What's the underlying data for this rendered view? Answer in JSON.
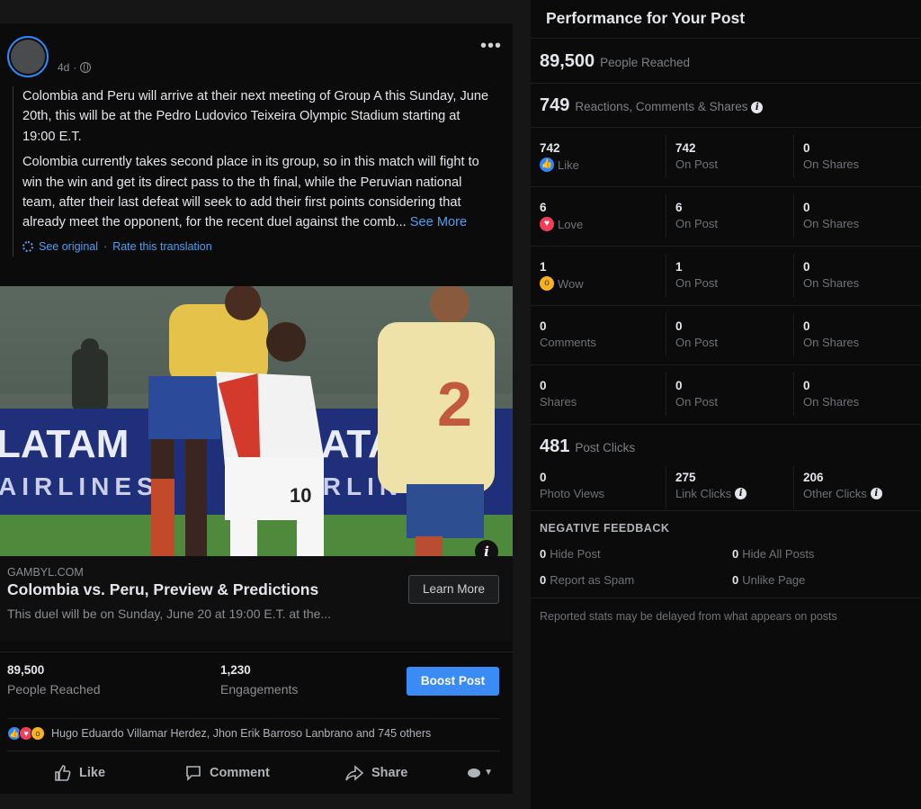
{
  "post": {
    "time": "4d",
    "more_label": "•••",
    "paragraph1": "Colombia and Peru will arrive at their next meeting of Group A this Sunday, June 20th, this will be at the Pedro Ludovico Teixeira Olympic Stadium starting at 19:00 E.T.",
    "paragraph2": "Colombia currently takes second place in its group, so in this match will fight to win the win and get its direct pass to the th final, while the Peruvian national team, after their last defeat will seek to add their first points considering that already meet the opponent, for the recent duel against the comb...",
    "see_more": "See More",
    "see_original": "See original",
    "rate_translation": "Rate this translation",
    "photo": {
      "sponsor_text_1": "LATAM",
      "sponsor_text_2": "AIRLINES",
      "sponsor_text_3": "LATA",
      "sponsor_text_4": "IRLIN",
      "player_number_right": "2",
      "player_number_center": "10"
    },
    "link": {
      "domain": "GAMBYL.COM",
      "title": "Colombia vs. Peru, Preview & Predictions",
      "description": "This duel will be on Sunday, June 20 at 19:00 E.T. at the...",
      "cta": "Learn More"
    },
    "insights": {
      "reached_value": "89,500",
      "reached_label": "People Reached",
      "engagements_value": "1,230",
      "engagements_label": "Engagements",
      "boost_label": "Boost Post"
    },
    "reactors": "Hugo Eduardo Villamar Herdez, Jhon Erik Barroso Lanbrano and 745 others",
    "actions": {
      "like": "Like",
      "comment": "Comment",
      "share": "Share"
    }
  },
  "panel": {
    "title": "Performance for Your Post",
    "reach_value": "89,500",
    "reach_label": "People Reached",
    "rcs_value": "749",
    "rcs_label": "Reactions, Comments & Shares",
    "rows": [
      {
        "v1": "742",
        "l1": "Like",
        "icon": "like-icon",
        "v2": "742",
        "l2": "On Post",
        "v3": "0",
        "l3": "On Shares"
      },
      {
        "v1": "6",
        "l1": "Love",
        "icon": "love-icon",
        "v2": "6",
        "l2": "On Post",
        "v3": "0",
        "l3": "On Shares"
      },
      {
        "v1": "1",
        "l1": "Wow",
        "icon": "wow-icon",
        "v2": "1",
        "l2": "On Post",
        "v3": "0",
        "l3": "On Shares"
      },
      {
        "v1": "0",
        "l1": "Comments",
        "icon": "",
        "v2": "0",
        "l2": "On Post",
        "v3": "0",
        "l3": "On Shares"
      },
      {
        "v1": "0",
        "l1": "Shares",
        "icon": "",
        "v2": "0",
        "l2": "On Post",
        "v3": "0",
        "l3": "On Shares"
      }
    ],
    "clicks_value": "481",
    "clicks_label": "Post Clicks",
    "photo_views_value": "0",
    "photo_views_label": "Photo Views",
    "link_clicks_value": "275",
    "link_clicks_label": "Link Clicks",
    "other_clicks_value": "206",
    "other_clicks_label": "Other Clicks",
    "negative_title": "NEGATIVE FEEDBACK",
    "hide_post_value": "0",
    "hide_post_label": "Hide Post",
    "hide_all_value": "0",
    "hide_all_label": "Hide All Posts",
    "spam_value": "0",
    "spam_label": "Report as Spam",
    "unlike_value": "0",
    "unlike_label": "Unlike Page",
    "footer": "Reported stats may be delayed from what appears on posts"
  },
  "colors": {
    "accent": "#3a8bf4",
    "like": "#2d88ff",
    "love": "#f33e58",
    "wow": "#f7b125"
  }
}
